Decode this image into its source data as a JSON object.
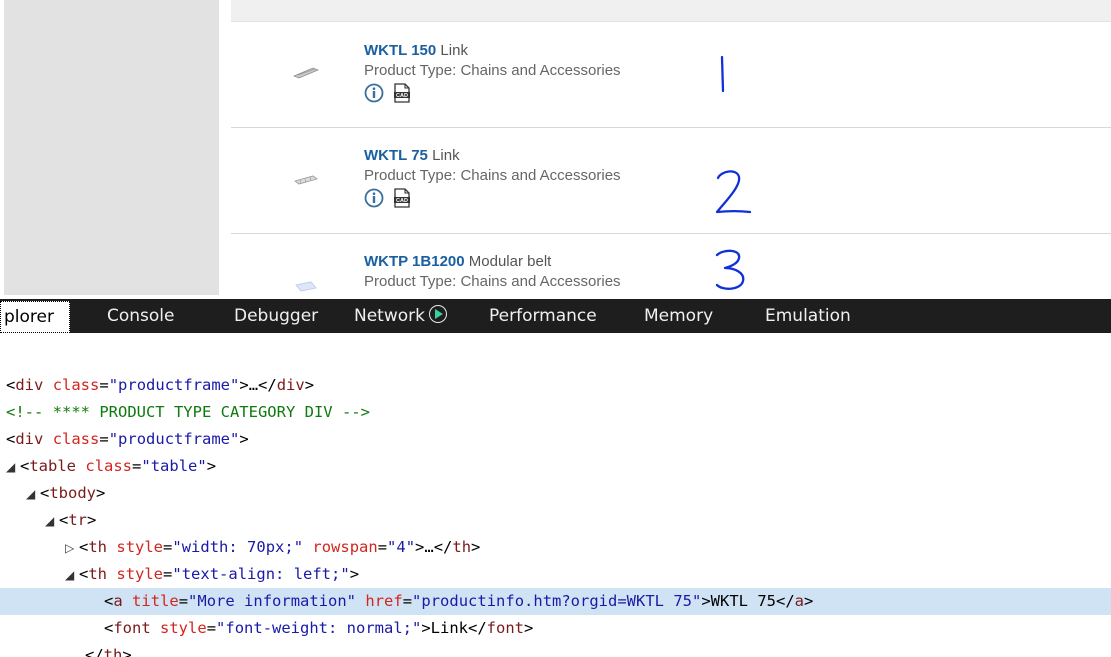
{
  "products": [
    {
      "code": "WKTL 150",
      "name": "Link",
      "type_label": "Product Type: Chains and Accessories",
      "annotation": "1"
    },
    {
      "code": "WKTL 75",
      "name": "Link",
      "type_label": "Product Type: Chains and Accessories",
      "annotation": "2"
    },
    {
      "code": "WKTP 1B1200",
      "name": "Modular belt",
      "type_label": "Product Type: Chains and Accessories",
      "annotation": "3"
    }
  ],
  "icons": {
    "info": "info-icon",
    "cad": "cad-icon"
  },
  "devtools": {
    "tabs": [
      "plorer",
      "Console",
      "Debugger",
      "Network",
      "Performance",
      "Memory",
      "Emulation"
    ],
    "dom_lines": [
      {
        "tag_open": "<",
        "tag": "div",
        "attr1": "class",
        "val1": "\"productframe\"",
        "rest": ">…</",
        "tag2": "div",
        "close": ">"
      },
      {
        "comment": "<!-- **** PRODUCT TYPE CATEGORY DIV -->"
      },
      {
        "tag_open": "<",
        "tag": "div",
        "attr1": "class",
        "val1": "\"productframe\"",
        "close": ">"
      },
      {
        "tag_open": "<",
        "tag": "table",
        "attr1": "class",
        "val1": "\"table\"",
        "close": ">"
      },
      {
        "tag_open": "<",
        "tag": "tbody",
        "close": ">"
      },
      {
        "tag_open": "<",
        "tag": "tr",
        "close": ">"
      },
      {
        "tag_open": "<",
        "tag": "th",
        "attr1": "style",
        "val1": "\"width: 70px;\"",
        "attr2": "rowspan",
        "val2": "\"4\"",
        "rest": ">…</",
        "tag2": "th",
        "close": ">"
      },
      {
        "tag_open": "<",
        "tag": "th",
        "attr1": "style",
        "val1": "\"text-align: left;\"",
        "close": ">"
      },
      {
        "tag_open": "<",
        "tag": "a",
        "attr1": "title",
        "val1": "\"More information\"",
        "attr2": "href",
        "val2": "\"productinfo.htm?orgid=WKTL 75\"",
        "rest": ">WKTL 75</",
        "tag2": "a",
        "close": ">"
      },
      {
        "tag_open": "<",
        "tag": "font",
        "attr1": "style",
        "val1": "\"font-weight: normal;\"",
        "rest": ">Link</",
        "tag2": "font",
        "close": ">"
      },
      {
        "tag_open": "</",
        "tag": "th",
        "close": ">"
      }
    ]
  },
  "colors": {
    "link_blue": "#1a5fa0",
    "ink_blue": "#1230d8",
    "devtools_bg": "#1e1e1e",
    "selection": "#cfe3f5"
  }
}
